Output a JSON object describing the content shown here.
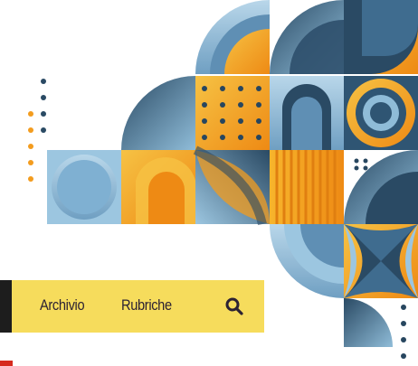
{
  "nav": {
    "links": [
      {
        "label": "Archivio"
      },
      {
        "label": "Rubriche"
      }
    ],
    "search_icon": "search-icon"
  },
  "colors": {
    "nav_background": "#f6dc5c",
    "nav_text": "#2c2233",
    "pattern_navy": "#27465f",
    "pattern_steel": "#3f6c8f",
    "pattern_sky": "#8fbcd8",
    "pattern_orange": "#f39c1e",
    "pattern_yellow": "#f6c244",
    "accent_red": "#d62a1e"
  }
}
